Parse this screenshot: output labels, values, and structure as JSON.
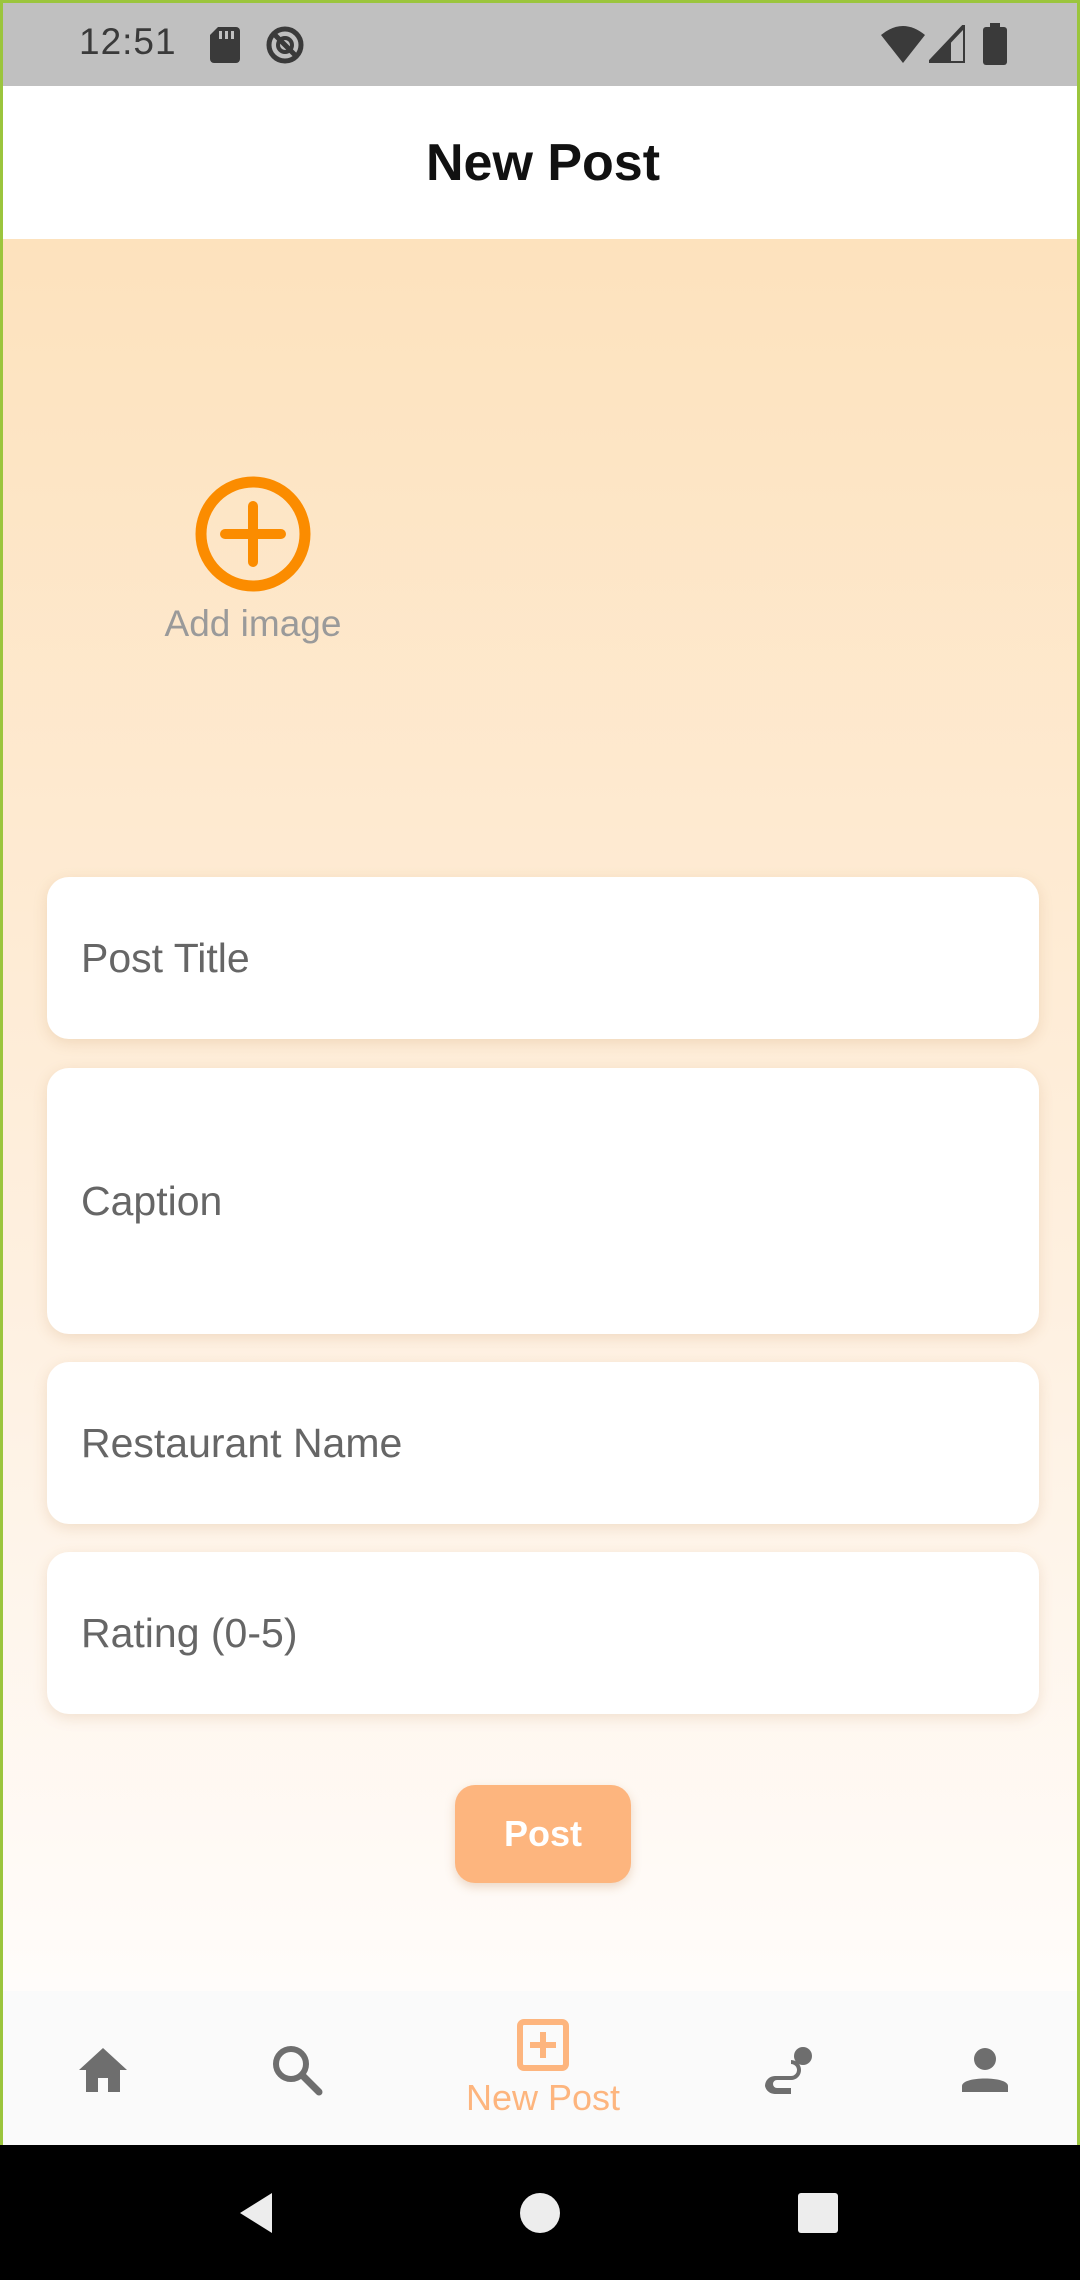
{
  "status_bar": {
    "time": "12:51",
    "icons": [
      "sd-card-icon",
      "do-not-disturb-icon",
      "wifi-icon",
      "signal-icon",
      "battery-icon"
    ]
  },
  "header": {
    "title": "New Post"
  },
  "add_image": {
    "label": "Add image",
    "icon": "add-circle-icon",
    "accent_color": "#fb8c00"
  },
  "form": {
    "post_title": {
      "placeholder": "Post Title",
      "value": ""
    },
    "caption": {
      "placeholder": "Caption",
      "value": ""
    },
    "restaurant_name": {
      "placeholder": "Restaurant Name",
      "value": ""
    },
    "rating": {
      "placeholder": "Rating (0-5)",
      "value": ""
    }
  },
  "post_button": {
    "label": "Post",
    "color": "#fdb57e"
  },
  "bottom_nav": {
    "items": [
      {
        "icon": "home-icon",
        "label": ""
      },
      {
        "icon": "search-icon",
        "label": ""
      },
      {
        "icon": "add-box-icon",
        "label": "New Post",
        "active": true
      },
      {
        "icon": "social-icon",
        "label": ""
      },
      {
        "icon": "person-icon",
        "label": ""
      }
    ],
    "active_color": "#fdb57e",
    "inactive_color": "#6e6e6e"
  },
  "system_nav": {
    "buttons": [
      "back-icon",
      "home-circle-icon",
      "recents-icon"
    ]
  }
}
